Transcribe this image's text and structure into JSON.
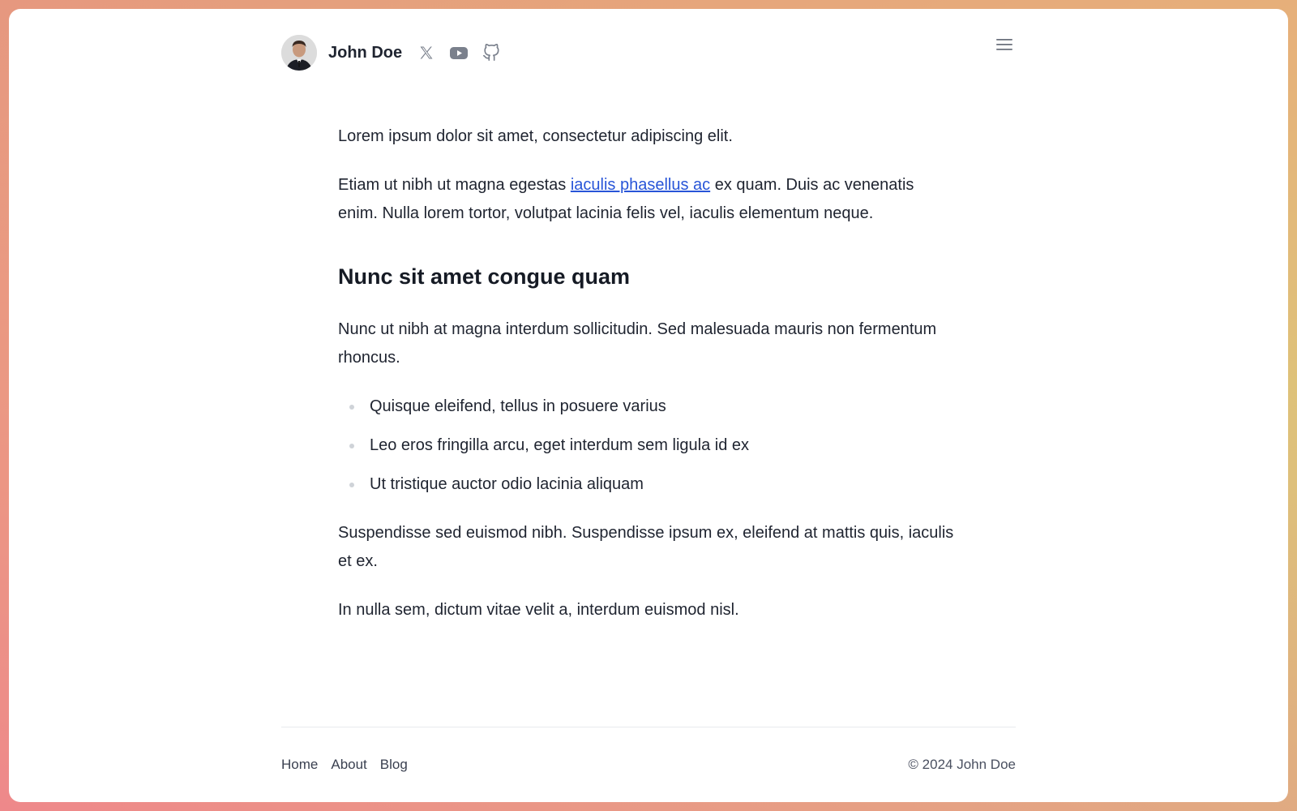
{
  "colors": {
    "text": "#1f2430",
    "link": "#2855d8",
    "icon": "#7a808c",
    "bullet": "#cfd3d8",
    "divider": "#e8eaed"
  },
  "header": {
    "name": "John Doe",
    "socials": [
      {
        "icon": "x-twitter-icon"
      },
      {
        "icon": "youtube-icon"
      },
      {
        "icon": "github-icon"
      }
    ],
    "menu_icon": "hamburger-menu-icon"
  },
  "content": {
    "p1": "Lorem ipsum dolor sit amet, consectetur adipiscing elit.",
    "p2_before": "Etiam ut nibh ut magna egestas ",
    "p2_link": "iaculis phasellus ac",
    "p2_after": " ex quam. Duis ac venenatis enim. Nulla lorem tortor, volutpat lacinia felis vel, iaculis elementum neque.",
    "heading": "Nunc sit amet congue quam",
    "p3": "Nunc ut nibh at magna interdum sollicitudin. Sed malesuada mauris non fermentum rhoncus.",
    "list": [
      "Quisque eleifend, tellus in posuere varius",
      "Leo eros fringilla arcu, eget interdum sem ligula id ex",
      "Ut tristique auctor odio lacinia aliquam"
    ],
    "p4": "Suspendisse sed euismod nibh. Suspendisse ipsum ex, eleifend at mattis quis, iaculis et ex.",
    "p5": "In nulla sem, dictum vitae velit a, interdum euismod nisl."
  },
  "footer": {
    "nav": [
      "Home",
      "About",
      "Blog"
    ],
    "copyright": "© 2024 John Doe"
  }
}
